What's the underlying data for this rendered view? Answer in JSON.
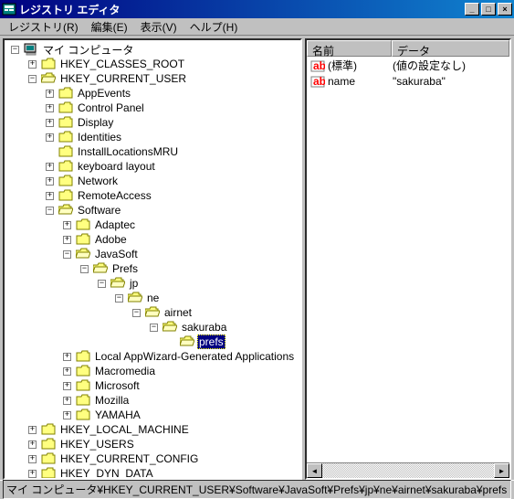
{
  "window": {
    "title": "レジストリ エディタ",
    "min": "_",
    "max": "□",
    "close": "×"
  },
  "menu": {
    "registry": "レジストリ(R)",
    "edit": "編集(E)",
    "view": "表示(V)",
    "help": "ヘルプ(H)"
  },
  "tree": {
    "root": "マイ コンピュータ",
    "hkcr": "HKEY_CLASSES_ROOT",
    "hkcu": "HKEY_CURRENT_USER",
    "appevents": "AppEvents",
    "controlpanel": "Control Panel",
    "display": "Display",
    "identities": "Identities",
    "installlocationsmru": "InstallLocationsMRU",
    "keyboardlayout": "keyboard layout",
    "network": "Network",
    "remoteaccess": "RemoteAccess",
    "software": "Software",
    "adaptec": "Adaptec",
    "adobe": "Adobe",
    "javasoft": "JavaSoft",
    "prefs": "Prefs",
    "jp": "jp",
    "ne": "ne",
    "airnet": "airnet",
    "sakuraba": "sakuraba",
    "prefsnode": "prefs",
    "localappwizard": "Local AppWizard-Generated Applications",
    "macromedia": "Macromedia",
    "microsoft": "Microsoft",
    "mozilla": "Mozilla",
    "yamaha": "YAMAHA",
    "hklm": "HKEY_LOCAL_MACHINE",
    "hku": "HKEY_USERS",
    "hkcc": "HKEY_CURRENT_CONFIG",
    "hkdd": "HKEY_DYN_DATA"
  },
  "listview": {
    "col_name": "名前",
    "col_data": "データ",
    "rows": {
      "0": {
        "name": "(標準)",
        "data": "(値の設定なし)"
      },
      "1": {
        "name": "name",
        "data": "\"sakuraba\""
      }
    }
  },
  "statusbar": {
    "path": "マイ コンピュータ¥HKEY_CURRENT_USER¥Software¥JavaSoft¥Prefs¥jp¥ne¥airnet¥sakuraba¥prefs"
  },
  "exp": {
    "plus": "+",
    "minus": "−"
  },
  "scroll": {
    "left": "◄",
    "right": "►"
  }
}
